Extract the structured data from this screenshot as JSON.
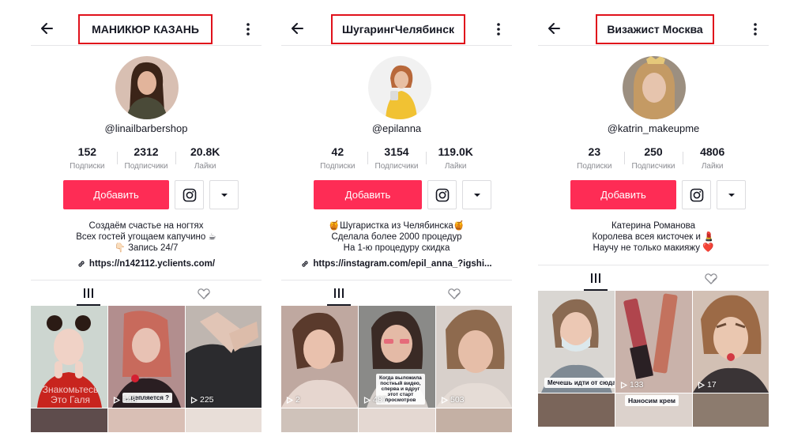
{
  "profiles": [
    {
      "title": "МАНИКЮР КАЗАНЬ",
      "handle": "@linailbarbershop",
      "stats": [
        {
          "value": "152",
          "label": "Подписки"
        },
        {
          "value": "2312",
          "label": "Подписчики"
        },
        {
          "value": "20.8K",
          "label": "Лайки"
        }
      ],
      "add_label": "Добавить",
      "bio": [
        "Создаём счастье на ногтях",
        "Всех гостей угощаем капучино ☕",
        "👇🏻 Запись 24/7"
      ],
      "link": "https://n142112.yclients.com/",
      "videos": [
        {
          "views": "",
          "caption": "",
          "watermark": "Знакомьтесь\nЭто Галя"
        },
        {
          "views": "148",
          "caption": "...цепляется ?",
          "watermark": ""
        },
        {
          "views": "225",
          "caption": "",
          "watermark": ""
        }
      ]
    },
    {
      "title": "ШугарингЧелябинск",
      "handle": "@epilanna",
      "stats": [
        {
          "value": "42",
          "label": "Подписки"
        },
        {
          "value": "3154",
          "label": "Подписчики"
        },
        {
          "value": "119.0K",
          "label": "Лайки"
        }
      ],
      "add_label": "Добавить",
      "bio": [
        "🍯Шугаристка из Челябинска🍯",
        "Сделала более 2000 процедур",
        "На 1-ю процедуру скидка"
      ],
      "link": "https://instagram.com/epil_anna_?igshi...",
      "videos": [
        {
          "views": "2",
          "caption": "",
          "watermark": ""
        },
        {
          "views": "487",
          "caption": "Когда выложила\nпостный видео,\nсперва и вдруг\nэтот старт\nпросмотров",
          "watermark": ""
        },
        {
          "views": "503",
          "caption": "",
          "watermark": ""
        }
      ]
    },
    {
      "title": "Визажист Москва",
      "handle": "@katrin_makeupme",
      "stats": [
        {
          "value": "23",
          "label": "Подписки"
        },
        {
          "value": "250",
          "label": "Подписчики"
        },
        {
          "value": "4806",
          "label": "Лайки"
        }
      ],
      "add_label": "Добавить",
      "bio": [
        "Катерина Романова",
        "Королева всея кисточек и 💄",
        "Научу не только макияжу ❤️"
      ],
      "link": "",
      "videos": [
        {
          "views": "",
          "caption": "Мечешь идти от сюда !",
          "watermark": ""
        },
        {
          "views": "133",
          "caption": "",
          "watermark": ""
        },
        {
          "views": "17",
          "caption": "",
          "watermark": ""
        }
      ],
      "extra_caption": "Наносим крем"
    }
  ],
  "colors": {
    "accent": "#fe2c55",
    "highlight": "#e0111b",
    "text": "#161823",
    "muted": "#8a8b91"
  }
}
